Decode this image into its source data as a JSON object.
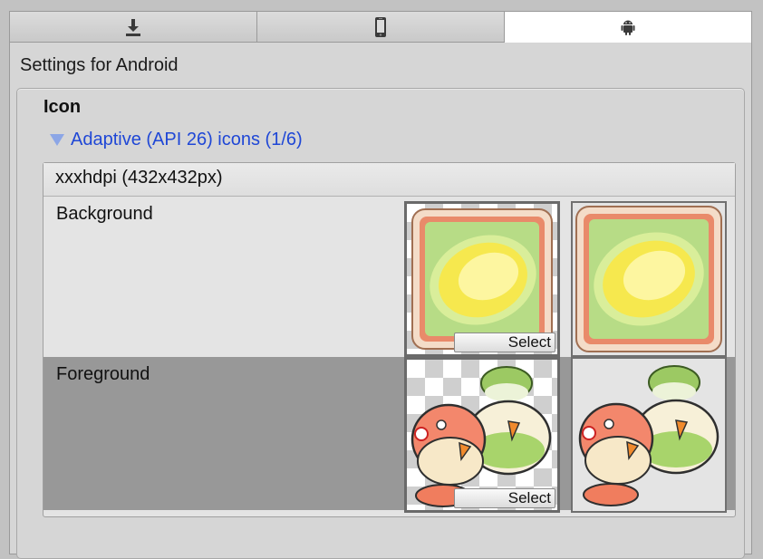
{
  "tabs": [
    {
      "icon": "download-icon",
      "active": false
    },
    {
      "icon": "phone-icon",
      "active": false
    },
    {
      "icon": "android-icon",
      "active": true
    }
  ],
  "settings_title": "Settings for Android",
  "section": {
    "heading": "Icon",
    "foldout_label": "Adaptive (API 26) icons (1/6)",
    "density_header": "xxxhdpi (432x432px)",
    "rows": [
      {
        "label": "Background",
        "select_label": "Select"
      },
      {
        "label": "Foreground",
        "select_label": "Select"
      }
    ]
  },
  "colors": {
    "accent_link": "#1f47d6",
    "foldout_arrow": "#8ca6e6",
    "selected_row": "#989898"
  }
}
